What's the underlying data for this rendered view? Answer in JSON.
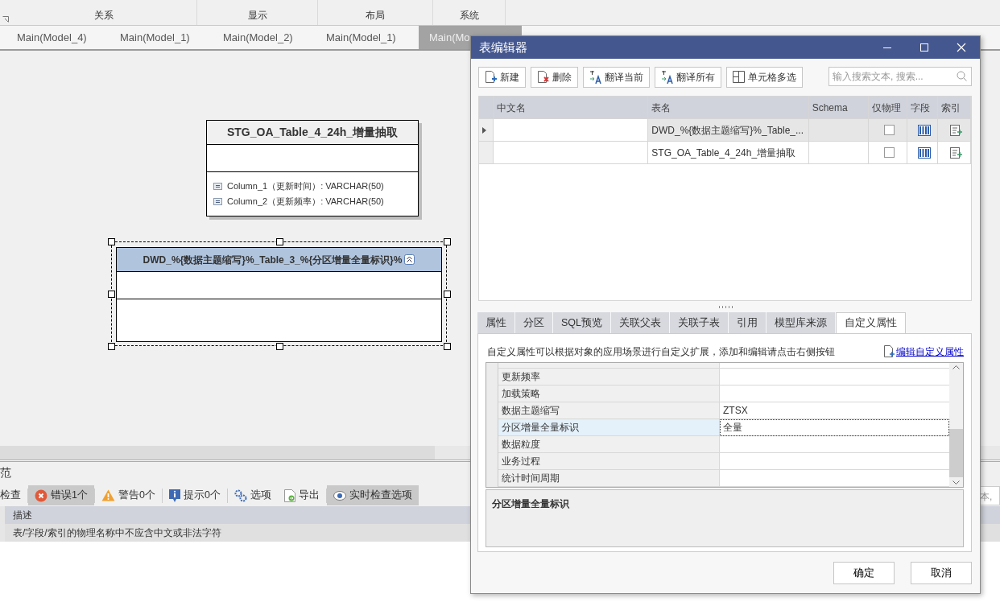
{
  "ribbon": {
    "groups": [
      "关系",
      "显示",
      "布局",
      "系统"
    ]
  },
  "doc_tabs": [
    {
      "label": "Main(Model_4)",
      "selected": false
    },
    {
      "label": "Main(Model_1)",
      "selected": false
    },
    {
      "label": "Main(Model_2)",
      "selected": false
    },
    {
      "label": "Main(Model_1)",
      "selected": false
    },
    {
      "label": "Main(Mo",
      "selected": true
    }
  ],
  "canvas": {
    "entities": [
      {
        "name": "STG_OA_Table_4_24h_增量抽取",
        "selected": false,
        "columns": [
          "Column_1（更新时间）: VARCHAR(50)",
          "Column_2（更新频率）: VARCHAR(50)"
        ]
      },
      {
        "name": "DWD_%{数据主题缩写}%_Table_3_%{分区增量全量标识}%",
        "selected": true
      }
    ]
  },
  "check_panel": {
    "title": "范",
    "toolbar": [
      {
        "label": "检查",
        "selected": false
      },
      {
        "label": "错误1个",
        "selected": true
      },
      {
        "label": "警告0个",
        "selected": false
      },
      {
        "label": "提示0个",
        "selected": false
      },
      {
        "label": "选项",
        "selected": false
      },
      {
        "label": "导出",
        "selected": false
      },
      {
        "label": "实时检查选项",
        "selected": true
      }
    ],
    "search_text": "本,",
    "columns": [
      "描述"
    ],
    "rows": [
      {
        "text": "表/字段/索引的物理名称中不应含中文或非法字符",
        "selected": true
      }
    ]
  },
  "dialog": {
    "title": "表编辑器",
    "toolbar": [
      "新建",
      "删除",
      "翻译当前",
      "翻译所有",
      "单元格多选"
    ],
    "search": {
      "placeholder": "输入搜索文本, 搜索..."
    },
    "table": {
      "columns": [
        "中文名",
        "表名",
        "Schema",
        "仅物理",
        "字段",
        "索引"
      ],
      "rows": [
        {
          "table_name": "DWD_%{数据主题缩写}%_Table_...",
          "physical_only": false,
          "selected": true
        },
        {
          "table_name": "STG_OA_Table_4_24h_增量抽取",
          "physical_only": false,
          "selected": false
        }
      ]
    },
    "tabs": [
      {
        "label": "属性",
        "selected": false
      },
      {
        "label": "分区",
        "selected": false
      },
      {
        "label": "SQL预览",
        "selected": false
      },
      {
        "label": "关联父表",
        "selected": false
      },
      {
        "label": "关联子表",
        "selected": false
      },
      {
        "label": "引用",
        "selected": false
      },
      {
        "label": "模型库来源",
        "selected": false
      },
      {
        "label": "自定义属性",
        "selected": true
      }
    ],
    "custom_props": {
      "hint": "自定义属性可以根据对象的应用场景进行自定义扩展，添加和编辑请点击右侧按钮",
      "edit_link": "编辑自定义属性",
      "properties": [
        {
          "name": "更新频率",
          "selected": false
        },
        {
          "name": "加载策略",
          "selected": false
        },
        {
          "name": "数据主题缩写",
          "value": "ZTSX",
          "selected": false
        },
        {
          "name": "分区增量全量标识",
          "value": "全量",
          "selected": true
        },
        {
          "name": "数据粒度",
          "selected": false
        },
        {
          "name": "业务过程",
          "selected": false
        },
        {
          "name": "统计时间周期",
          "selected": false
        }
      ],
      "description": "分区增量全量标识"
    },
    "buttons": [
      "确定",
      "取消"
    ]
  }
}
